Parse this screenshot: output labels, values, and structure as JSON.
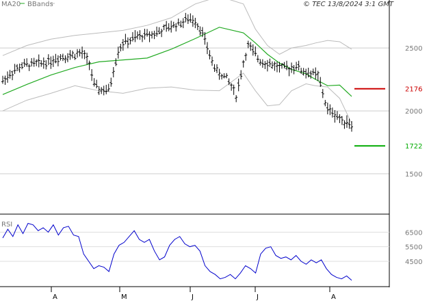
{
  "header": {
    "legend_ma": "MA20",
    "legend_bb": "BBands",
    "copyright": "© TEC 13/8/2024 3:1 GMT"
  },
  "rsi_label": "RSI",
  "chart_data": [
    {
      "type": "candlestick",
      "title": "",
      "xlabel": "",
      "ylabel": "",
      "ylim": [
        1250,
        2800
      ],
      "y_ticks": [
        {
          "value": 2500,
          "label": "2500"
        },
        {
          "value": 2000,
          "label": "2000"
        },
        {
          "value": 1500,
          "label": "1500"
        }
      ],
      "x_ticks": [
        "A",
        "M",
        "J",
        "J",
        "A"
      ],
      "grid": "horizontal",
      "colors": {
        "ma20": "#22aa22",
        "bbands": "#bbbbbb",
        "bars": "#000000",
        "resistance": "#cc0000",
        "support": "#00aa00"
      },
      "levels": [
        {
          "name": "resistance",
          "value": 2176,
          "label": "2176"
        },
        {
          "name": "support",
          "value": 1722,
          "label": "1722"
        }
      ],
      "series": [
        {
          "name": "MA20",
          "x": [
            0,
            10,
            20,
            30,
            40,
            50,
            60,
            70,
            80,
            90,
            100,
            105,
            110,
            115,
            120,
            126,
            130,
            135,
            140,
            145
          ],
          "values": [
            2130,
            2210,
            2285,
            2345,
            2390,
            2405,
            2420,
            2490,
            2575,
            2665,
            2620,
            2540,
            2450,
            2380,
            2330,
            2295,
            2250,
            2200,
            2205,
            2115
          ]
        },
        {
          "name": "BBands",
          "x": [
            0,
            10,
            20,
            30,
            40,
            50,
            60,
            70,
            80,
            90,
            100,
            105,
            110,
            115,
            120,
            126,
            130,
            135,
            140,
            145
          ],
          "values": [
            2440,
            2520,
            2570,
            2600,
            2620,
            2640,
            2680,
            2740,
            2850,
            2910,
            2850,
            2650,
            2520,
            2450,
            2500,
            2520,
            2540,
            2560,
            2550,
            2490
          ]
        },
        {
          "name": "BBands",
          "x": [
            0,
            10,
            20,
            30,
            40,
            50,
            60,
            70,
            80,
            90,
            100,
            105,
            110,
            115,
            120,
            126,
            130,
            135,
            140,
            145
          ],
          "values": [
            2000,
            2085,
            2140,
            2200,
            2160,
            2140,
            2180,
            2190,
            2165,
            2160,
            2300,
            2160,
            2040,
            2050,
            2160,
            2215,
            2200,
            2190,
            2100,
            1900
          ]
        },
        {
          "name": "Price",
          "x": [
            0,
            4,
            8,
            12,
            16,
            20,
            24,
            28,
            33,
            36,
            38,
            40,
            44,
            48,
            50,
            53,
            56,
            59,
            62,
            65,
            68,
            71,
            74,
            77,
            80,
            83,
            86,
            89,
            90,
            93,
            95,
            97,
            100,
            102,
            104,
            107,
            110,
            113,
            116,
            119,
            122,
            125,
            128,
            131,
            134,
            135,
            137,
            139,
            141,
            143,
            145
          ],
          "values": [
            2240,
            2310,
            2360,
            2370,
            2380,
            2400,
            2430,
            2440,
            2460,
            2380,
            2200,
            2170,
            2160,
            2480,
            2540,
            2560,
            2590,
            2600,
            2610,
            2630,
            2655,
            2680,
            2700,
            2730,
            2720,
            2620,
            2440,
            2310,
            2300,
            2260,
            2200,
            2120,
            2380,
            2520,
            2470,
            2400,
            2380,
            2360,
            2340,
            2340,
            2360,
            2310,
            2300,
            2280,
            2070,
            2010,
            1990,
            1960,
            1920,
            1920,
            1890
          ]
        }
      ]
    },
    {
      "type": "line",
      "title": "RSI",
      "ylim": [
        30,
        75
      ],
      "y_ticks": [
        {
          "value": 65,
          "label": "6500"
        },
        {
          "value": 55,
          "label": "5500"
        },
        {
          "value": 45,
          "label": "4500"
        }
      ],
      "x_ticks": [
        "A",
        "M",
        "J",
        "J",
        "A"
      ],
      "grid": "horizontal",
      "series": [
        {
          "name": "RSI",
          "color": "#0000cc",
          "values": [
            61,
            67,
            62,
            70,
            64,
            71,
            70,
            66,
            68,
            65,
            70,
            63,
            68,
            69,
            63,
            62,
            50,
            45,
            40,
            42,
            41,
            38,
            50,
            56,
            58,
            62,
            66,
            60,
            58,
            60,
            52,
            46,
            48,
            56,
            60,
            62,
            57,
            55,
            56,
            52,
            42,
            38,
            36,
            33,
            34,
            36,
            33,
            37,
            42,
            40,
            37,
            50,
            54,
            55,
            49,
            47,
            48,
            46,
            49,
            45,
            43,
            46,
            44,
            46,
            40,
            36,
            34,
            33,
            35,
            32
          ]
        }
      ]
    }
  ]
}
